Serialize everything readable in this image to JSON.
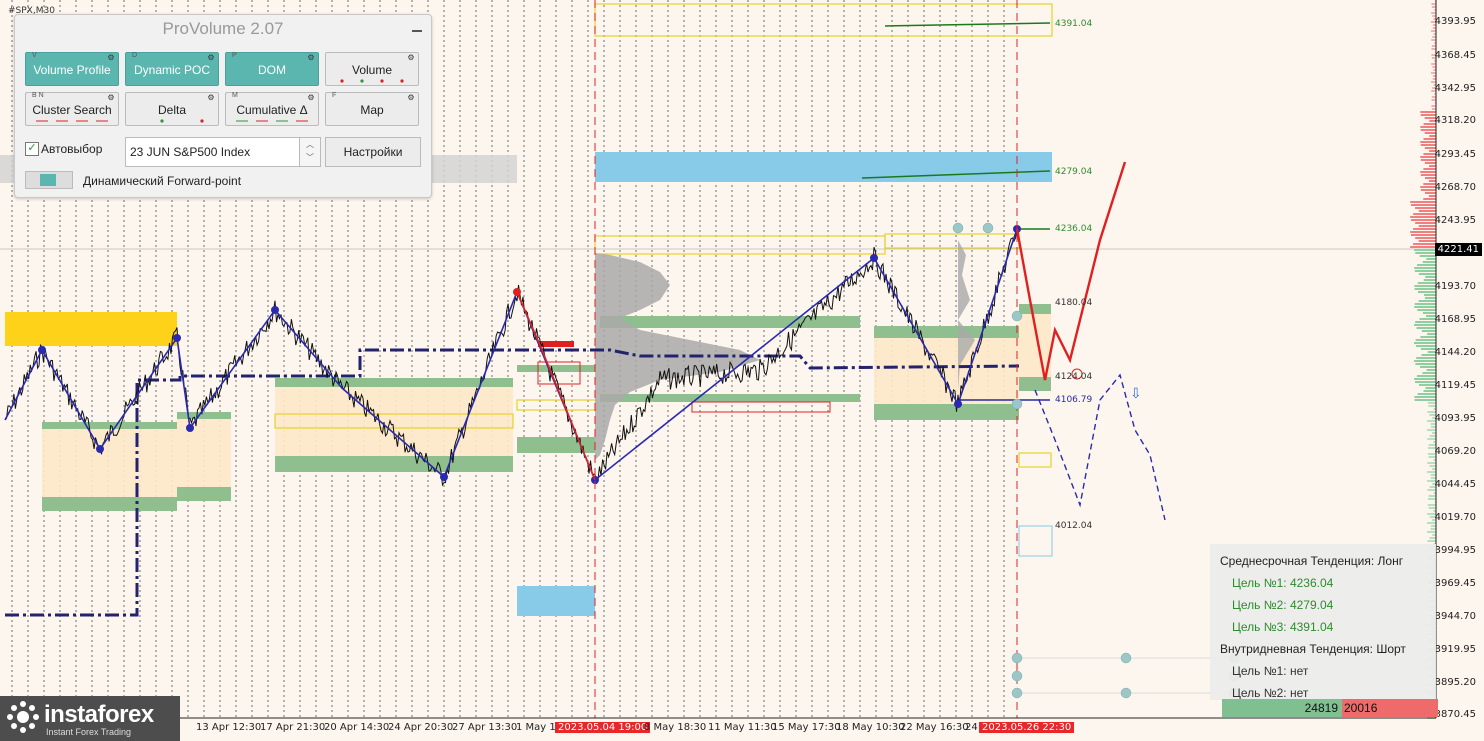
{
  "symbol": "#SPX,M30",
  "panel": {
    "title": "ProVolume 2.07",
    "buttons": [
      {
        "key": "V",
        "label": "Volume Profile",
        "active": true
      },
      {
        "key": "D",
        "label": "Dynamic POC",
        "active": true
      },
      {
        "key": "P",
        "label": "DOM",
        "active": true
      },
      {
        "key": "",
        "label": "Volume",
        "active": false
      },
      {
        "key": "B N",
        "label": "Cluster Search",
        "active": false
      },
      {
        "key": "",
        "label": "Delta",
        "active": false
      },
      {
        "key": "M",
        "label": "Cumulative Δ",
        "active": false
      },
      {
        "key": "F",
        "label": "Map",
        "active": false
      }
    ],
    "auto_select_label": "Автовыбор",
    "auto_select_checked": true,
    "instrument_value": "23 JUN S&P500 Index",
    "settings_label": "Настройки",
    "forward_point_label": "Динамический Forward-point"
  },
  "price_axis": [
    "4393.95",
    "4368.45",
    "4342.95",
    "4318.20",
    "4293.45",
    "4268.70",
    "4243.95",
    "4193.70",
    "4168.95",
    "4144.20",
    "4119.45",
    "4093.95",
    "4069.20",
    "4044.45",
    "4019.70",
    "3994.95",
    "3969.45",
    "3944.70",
    "3919.95",
    "3895.20",
    "3870.45"
  ],
  "current_price": "4221.41",
  "levels": [
    {
      "label": "4391.04",
      "color": "#2e8b2e"
    },
    {
      "label": "4279.04",
      "color": "#2e8b2e"
    },
    {
      "label": "4236.04",
      "color": "#2e8b2e"
    },
    {
      "label": "4180.04",
      "color": "#333333"
    },
    {
      "label": "4124.04",
      "color": "#333333"
    },
    {
      "label": "4106.79",
      "color": "#2a2aa0"
    },
    {
      "label": "4012.04",
      "color": "#333333"
    }
  ],
  "time_axis": [
    {
      "label": "13 Apr 12:30",
      "hl": false
    },
    {
      "label": "17 Apr 21:30",
      "hl": false
    },
    {
      "label": "20 Apr 14:30",
      "hl": false
    },
    {
      "label": "24 Apr 20:30",
      "hl": false
    },
    {
      "label": "27 Apr 13:30",
      "hl": false
    },
    {
      "label": "1 May 19",
      "hl": false
    },
    {
      "label": "2023.05.04 19:00",
      "hl": true
    },
    {
      "label": "8 May 18:30",
      "hl": false
    },
    {
      "label": "11 May 11:30",
      "hl": false
    },
    {
      "label": "15 May 17:30",
      "hl": false
    },
    {
      "label": "18 May 10:30",
      "hl": false
    },
    {
      "label": "22 May 16:30",
      "hl": false
    },
    {
      "label": "24",
      "hl": false
    },
    {
      "label": "2023.05.26 22:30",
      "hl": true
    }
  ],
  "trend": {
    "medium_title": "Среднесрочная Тенденция: Лонг",
    "medium_targets": [
      "Цель №1: 4236.04",
      "Цель №2: 4279.04",
      "Цель №3: 4391.04"
    ],
    "intraday_title": "Внутридневная Тенденция: Шорт",
    "intraday_targets": [
      "Цель №1: нет",
      "Цель №2: нет"
    ],
    "buy_volume": "24819",
    "sell_volume": "20016"
  },
  "logo": {
    "name": "instaforex",
    "tagline": "Instant Forex Trading"
  }
}
